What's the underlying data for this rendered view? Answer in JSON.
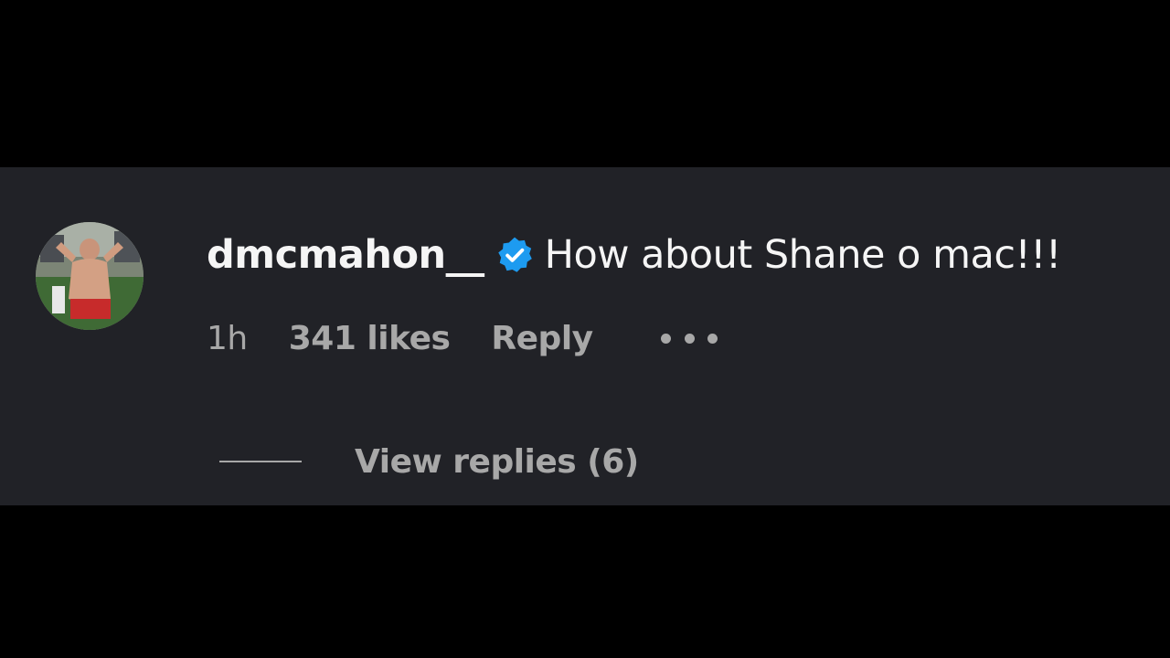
{
  "comment": {
    "username": "dmcmahon__",
    "verified": true,
    "text": "How about Shane o mac!!!",
    "time": "1h",
    "likes": "341 likes",
    "reply_label": "Reply",
    "more_icon": "more-horizontal-icon",
    "view_replies_label": "View replies (6)"
  },
  "colors": {
    "background": "#000000",
    "panel": "#212227",
    "primary_text": "#f5f5f5",
    "secondary_text": "#a8a8a8",
    "verified_badge": "#1d9bf0"
  }
}
